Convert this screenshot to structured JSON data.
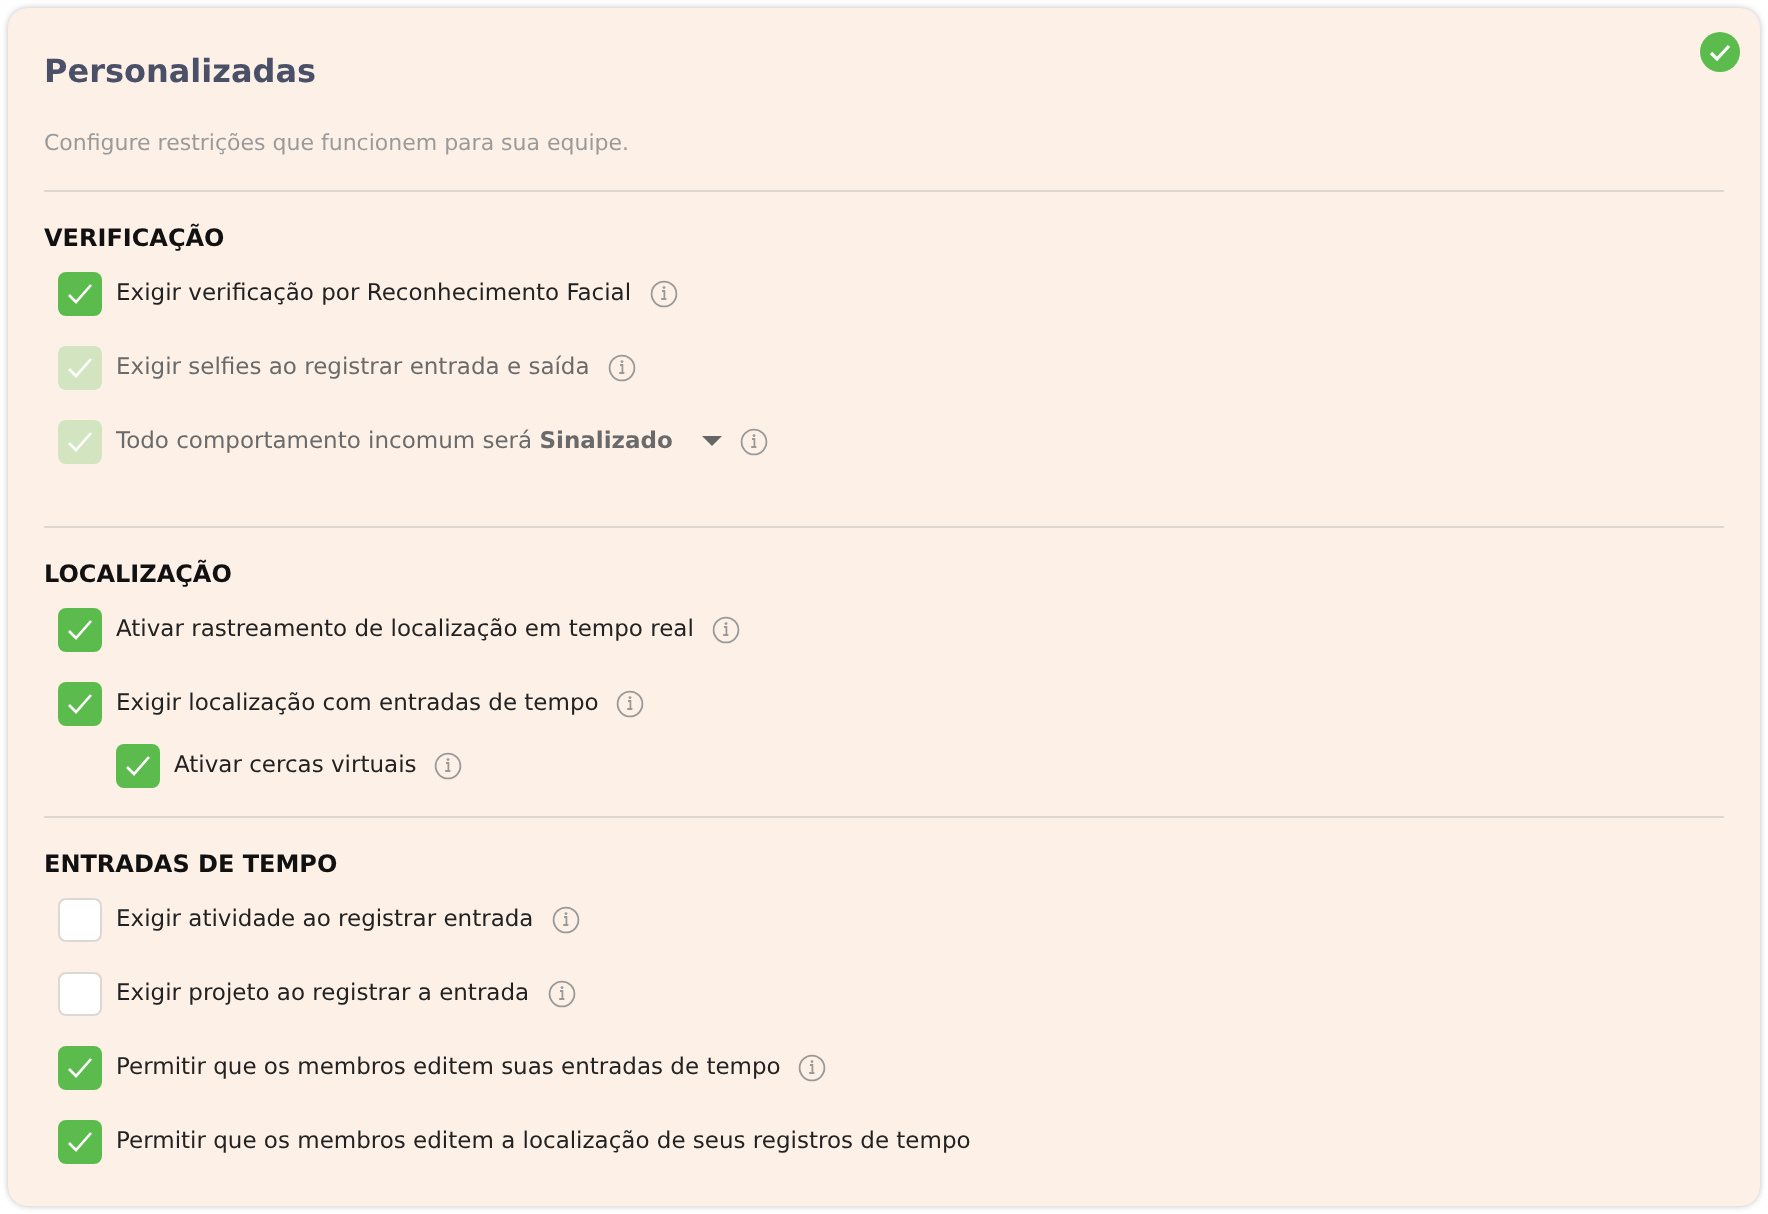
{
  "panel": {
    "title": "Personalizadas",
    "subtitle": "Configure restrições que funcionem para sua equipe.",
    "enabled": true
  },
  "sections": [
    {
      "heading": "VERIFICAÇÃO",
      "options": [
        {
          "label": "Exigir verificação por Reconhecimento Facial",
          "checked": true,
          "disabled": false,
          "info": true
        },
        {
          "label": "Exigir selfies ao registrar entrada e saída",
          "checked": true,
          "disabled": true,
          "info": true
        },
        {
          "label": "Todo comportamento incomum será **Sinalizado**",
          "checked": true,
          "disabled": true,
          "info": true,
          "dropdown": true
        }
      ]
    },
    {
      "heading": "LOCALIZAÇÃO",
      "options": [
        {
          "label": "Ativar rastreamento de localização em tempo real",
          "checked": true,
          "disabled": false,
          "info": true
        },
        {
          "label": "Exigir localização com entradas de tempo",
          "checked": true,
          "disabled": false,
          "info": true,
          "children": [
            {
              "label": "Ativar cercas virtuais",
              "checked": true,
              "disabled": false,
              "info": true
            }
          ]
        }
      ]
    },
    {
      "heading": "ENTRADAS DE TEMPO",
      "options": [
        {
          "label": "Exigir atividade ao registrar entrada",
          "checked": false,
          "disabled": false,
          "info": true
        },
        {
          "label": "Exigir projeto ao registrar a entrada",
          "checked": false,
          "disabled": false,
          "info": true
        },
        {
          "label": "Permitir que os membros editem suas entradas de tempo",
          "checked": true,
          "disabled": false,
          "info": true
        },
        {
          "label": "Permitir que os membros editem a localização de seus registros de tempo",
          "checked": true,
          "disabled": false,
          "info": false
        }
      ]
    }
  ]
}
